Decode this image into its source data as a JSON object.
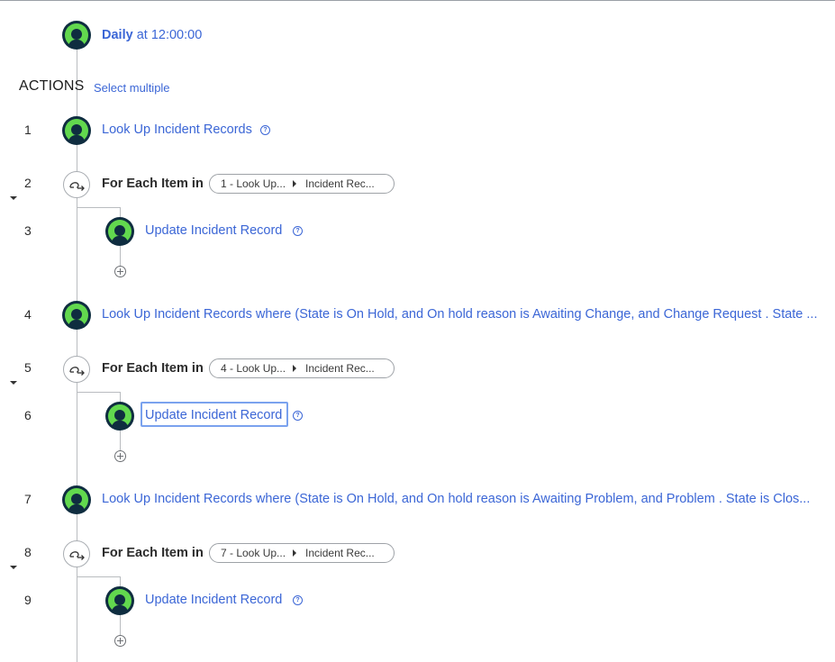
{
  "trigger": {
    "frequency": "Daily",
    "time_text": "at 12:00:00"
  },
  "actions_section": {
    "heading": "ACTIONS",
    "select_multiple": "Select multiple"
  },
  "steps": [
    {
      "num": "1",
      "label": "Look Up Incident Records",
      "condition": ""
    },
    {
      "num": "2",
      "label": "For Each Item in",
      "pill_source": "1 - Look Up...",
      "pill_target": "Incident Rec..."
    },
    {
      "num": "3",
      "label": "Update Incident Record"
    },
    {
      "num": "4",
      "label": "Look Up Incident Records",
      "condition": "where (State is On Hold, and On hold reason is Awaiting Change, and Change Request . State ..."
    },
    {
      "num": "5",
      "label": "For Each Item in",
      "pill_source": "4 - Look Up...",
      "pill_target": "Incident Rec..."
    },
    {
      "num": "6",
      "label": "Update Incident Record"
    },
    {
      "num": "7",
      "label": "Look Up Incident Records",
      "condition": "where (State is On Hold, and On hold reason is Awaiting Problem, and Problem . State is Clos..."
    },
    {
      "num": "8",
      "label": "For Each Item in",
      "pill_source": "7 - Look Up...",
      "pill_target": "Incident Rec..."
    },
    {
      "num": "9",
      "label": "Update Incident Record"
    }
  ],
  "colors": {
    "link": "#3b66d6",
    "icon_dark": "#0f2d40",
    "icon_green": "#62d84e"
  },
  "icons": {
    "action": "action-record-icon",
    "loop": "loop-icon",
    "help": "help-icon",
    "add": "add-step-icon",
    "collapse": "collapse-caret-icon"
  }
}
